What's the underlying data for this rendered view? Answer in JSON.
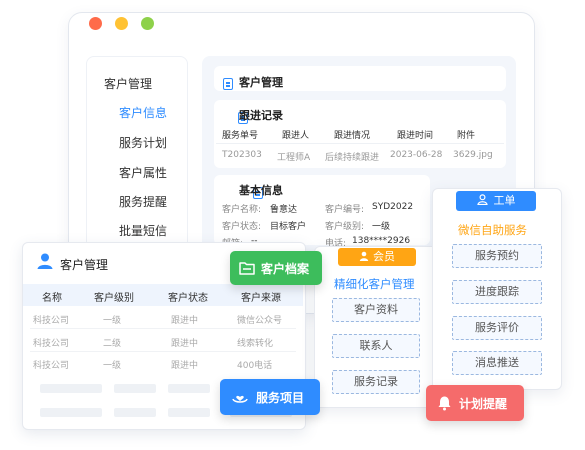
{
  "window": {
    "sidebar": {
      "title": "客户管理",
      "items": [
        "客户信息",
        "服务计划",
        "客户属性",
        "服务提醒",
        "批量短信"
      ]
    },
    "content": {
      "header": "客户管理",
      "follow": {
        "title": "跟进记录",
        "columns": [
          "服务单号",
          "跟进人",
          "跟进情况",
          "跟进时间",
          "附件"
        ],
        "row": [
          "T202303",
          "工程师A",
          "后续持续跟进",
          "2023-06-28",
          "3629.jpg"
        ]
      },
      "basic": {
        "title": "基本信息",
        "name_label": "客户名称:",
        "name": "鲁意达",
        "code_label": "客户编号:",
        "code": "SYD2022",
        "status_label": "客户状态:",
        "status": "目标客户",
        "level_label": "客户级别:",
        "level": "一级",
        "email_label": "邮箱:",
        "email": "--",
        "phone_label": "电话:",
        "phone": "138****2926"
      }
    }
  },
  "cm_panel": {
    "title": "客户管理",
    "columns": [
      "名称",
      "客户级别",
      "客户状态",
      "客户来源"
    ],
    "rows": [
      [
        "科技公司",
        "一级",
        "跟进中",
        "微信公众号"
      ],
      [
        "科技公司",
        "二级",
        "跟进中",
        "线索转化"
      ],
      [
        "科技公司",
        "一级",
        "跟进中",
        "400电话"
      ]
    ]
  },
  "member": {
    "tag": "会员",
    "title": "精细化客户管理",
    "buttons": [
      "客户资料",
      "联系人",
      "服务记录"
    ]
  },
  "ticket": {
    "tag": "工单",
    "title": "微信自助服务",
    "buttons": [
      "服务预约",
      "进度跟踪",
      "服务评价",
      "消息推送"
    ]
  },
  "floats": {
    "archive": "客户档案",
    "project": "服务项目",
    "reminder": "计划提醒"
  },
  "colors": {
    "accent": "#2f8cff",
    "green": "#3dbd5c",
    "orange": "#ffa514",
    "red": "#f56b6b",
    "traffic": [
      "#ff6b4a",
      "#ffc233",
      "#8ed14a"
    ]
  }
}
